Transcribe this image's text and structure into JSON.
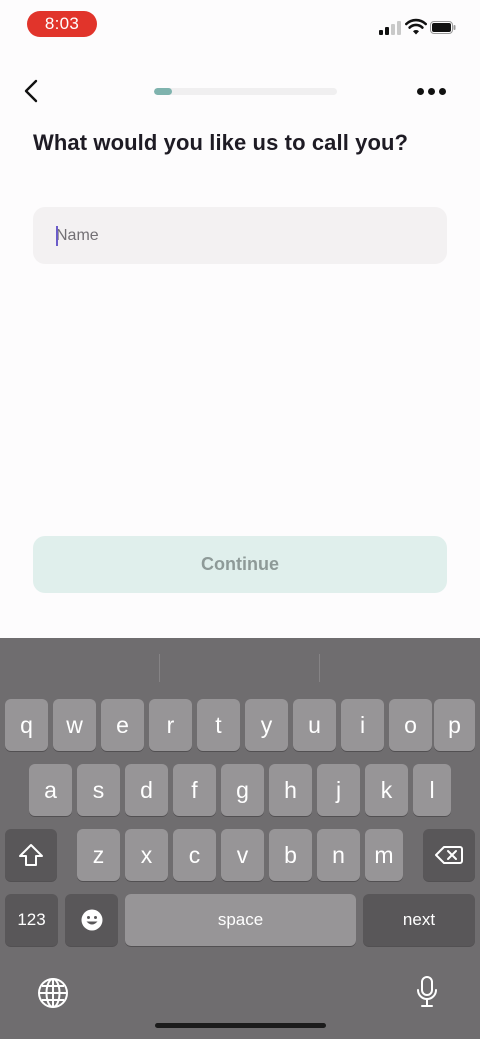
{
  "status": {
    "time": "8:03"
  },
  "header": {
    "progress": 0.1,
    "back_icon": "chevron-left-icon",
    "more_icon": "more-horizontal-icon"
  },
  "main": {
    "question": "What would you like us to call you?",
    "name_input": {
      "placeholder": "Name",
      "value": ""
    },
    "continue_label": "Continue"
  },
  "keyboard": {
    "row1": [
      "q",
      "w",
      "e",
      "r",
      "t",
      "y",
      "u",
      "i",
      "o",
      "p"
    ],
    "row2": [
      "a",
      "s",
      "d",
      "f",
      "g",
      "h",
      "j",
      "k",
      "l"
    ],
    "row3": [
      "z",
      "x",
      "c",
      "v",
      "b",
      "n",
      "m"
    ],
    "numbers_label": "123",
    "space_label": "space",
    "next_label": "next",
    "icons": [
      "shift-icon",
      "backspace-icon",
      "emoji-icon",
      "globe-icon",
      "microphone-icon"
    ]
  },
  "colors": {
    "time_pill": "#e1342b",
    "progress_fill": "#7fb3ae",
    "continue_bg": "#e0efec",
    "keyboard_bg": "#6f6d6f"
  }
}
